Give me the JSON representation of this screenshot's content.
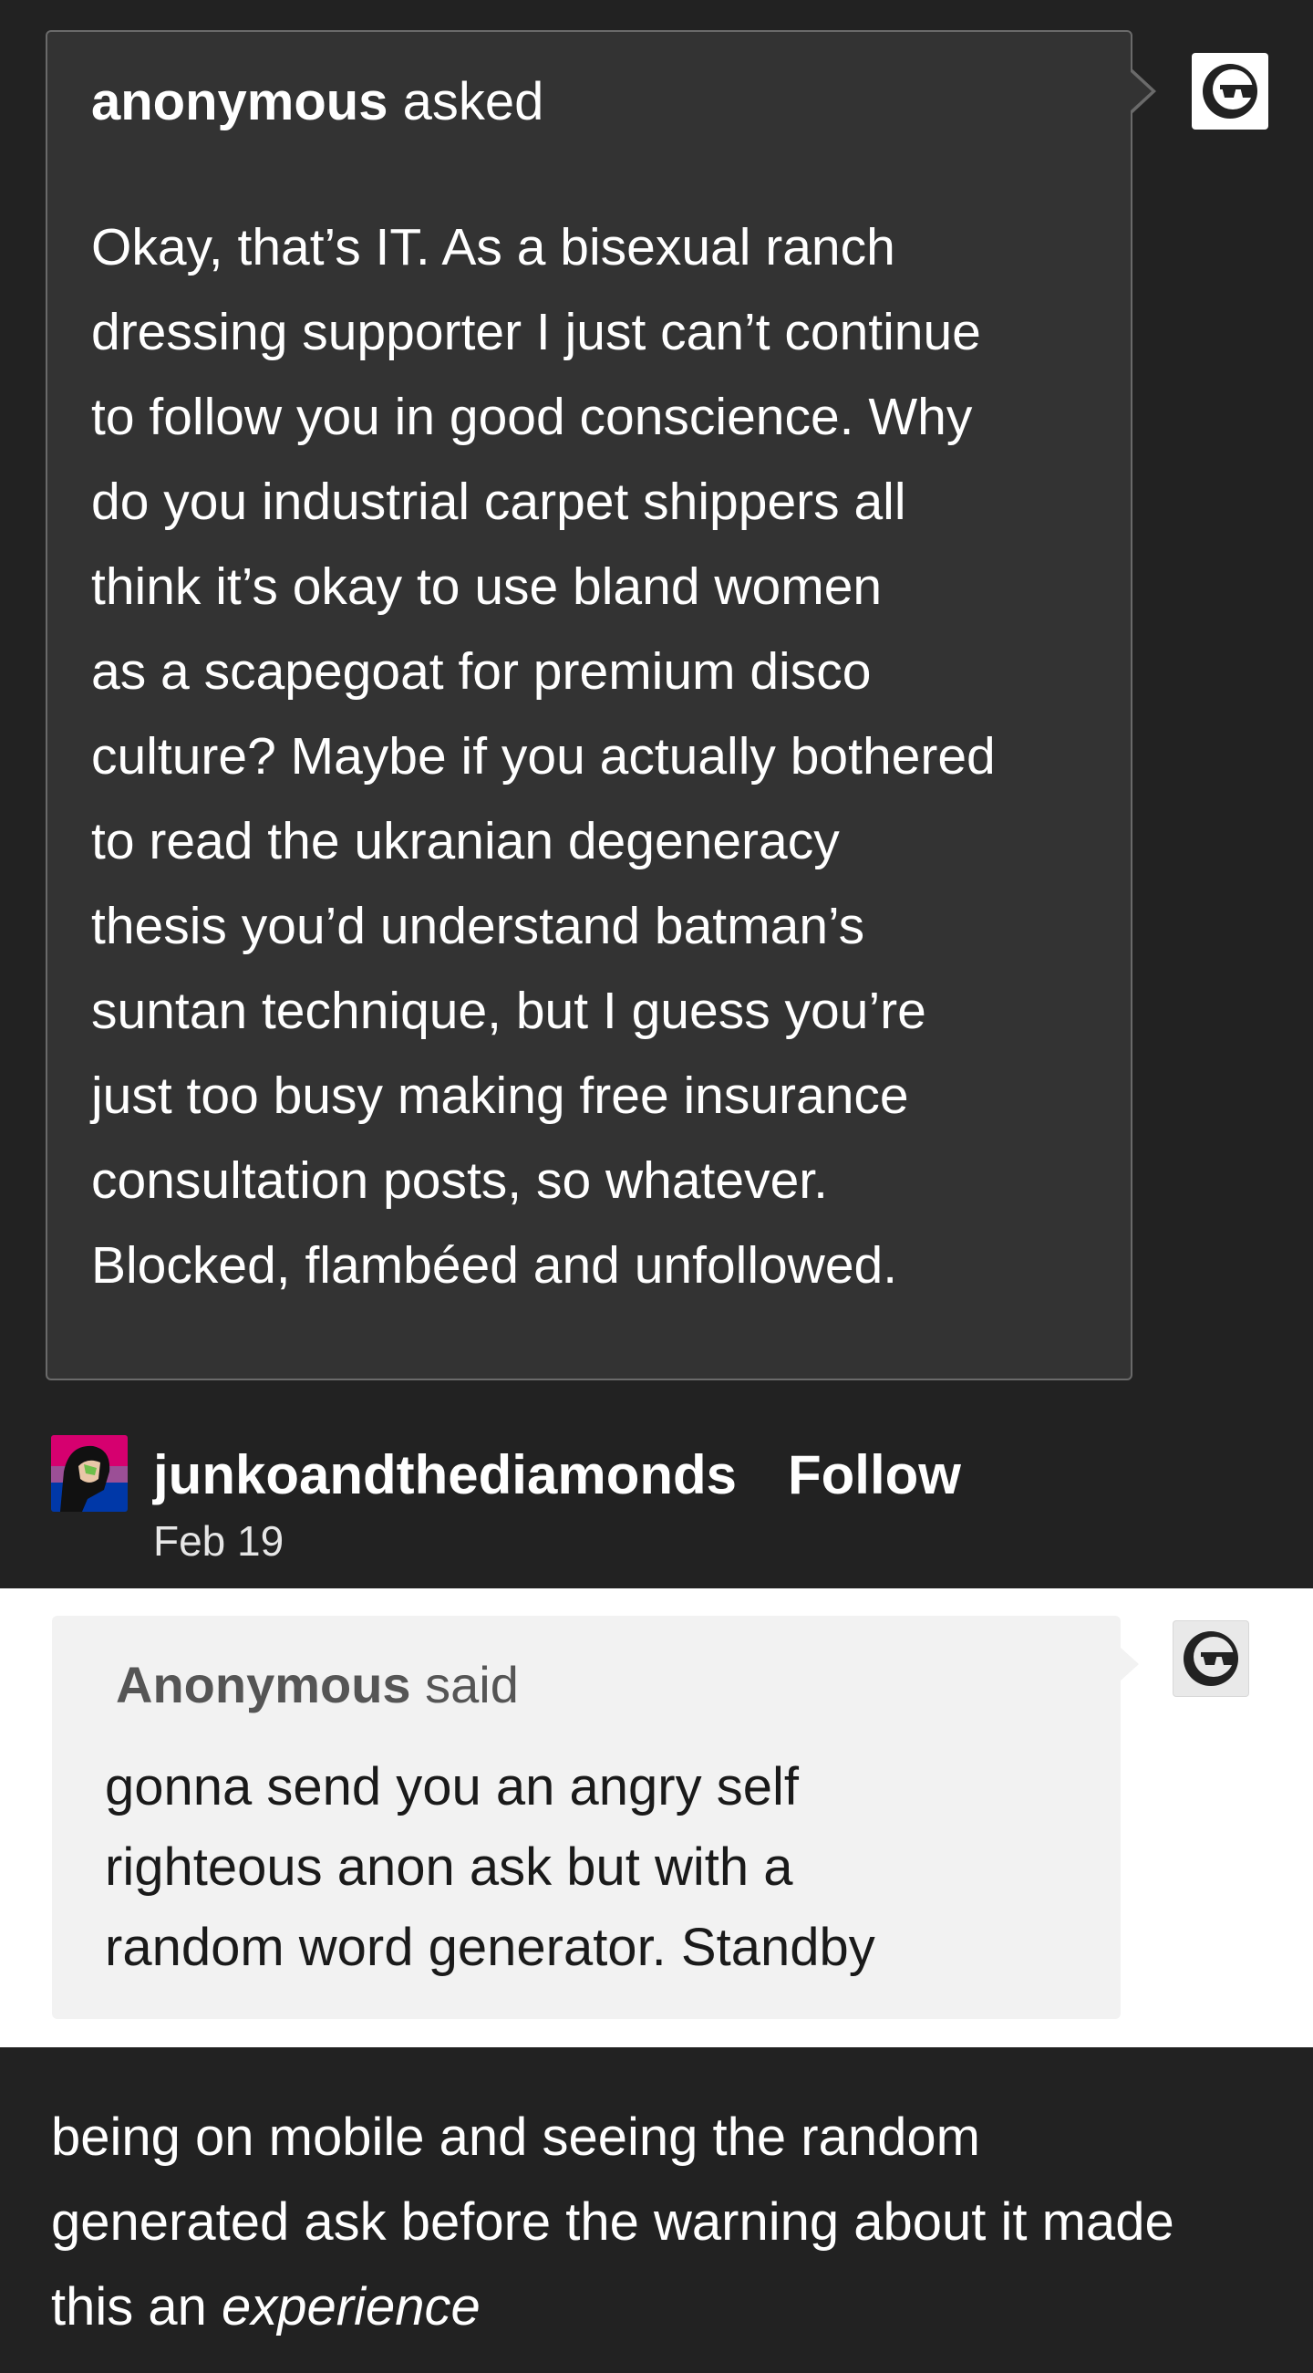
{
  "ask": {
    "asker": "anonymous",
    "verb": "asked",
    "lines": [
      "Okay, that’s IT. As a bisexual ranch",
      "dressing supporter I just can’t continue",
      "to follow you in good conscience. Why",
      "do you industrial carpet shippers all",
      "think it’s okay to use bland women",
      "as a scapegoat for premium disco",
      "culture? Maybe if you actually bothered",
      "to read the ukranian degeneracy",
      "thesis you’d understand batman’s",
      "suntan technique, but I guess you’re",
      "just too busy making free insurance",
      "consultation posts, so whatever.",
      "Blocked, flambéed and unfollowed."
    ],
    "avatar_icon": "anonymous-sunglasses-icon"
  },
  "post": {
    "blog_name": "junkoandthediamonds",
    "follow_label": "Follow",
    "date": "Feb 19",
    "avatar_icon": "blog-avatar-image",
    "avatar_colors": [
      "#d6006f",
      "#9b4f96",
      "#0038a8"
    ]
  },
  "quoted": {
    "asker": "Anonymous",
    "verb": "said",
    "lines": [
      "gonna send you an angry self",
      "righteous anon ask but with a",
      "random word generator. Standby"
    ],
    "avatar_icon": "anonymous-sunglasses-icon"
  },
  "comment": {
    "line1": "being on mobile and seeing the random",
    "line2": "generated ask before the warning about it made",
    "line3_prefix": "this an ",
    "line3_emphasis": "experience"
  },
  "colors": {
    "background": "#222222",
    "ask_box": "#333333",
    "quote_box": "#f2f2f2"
  }
}
